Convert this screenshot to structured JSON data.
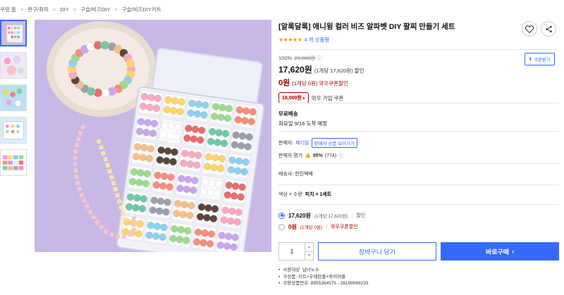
{
  "breadcrumb": [
    "쿠팡 홈",
    "완구/취미",
    "DIY",
    "구슬/비즈DIY",
    "구슬/비즈DIY키트"
  ],
  "product": {
    "title": "[알록달록] 애니윙 컬러 비즈 알파벳 DIY 팔찌 만들기 세트",
    "stars": "★★★★★",
    "review_count": "4 개 상품평"
  },
  "price": {
    "discount_rate": "100%",
    "original_price": "29,800원",
    "sale_price": "17,620원",
    "sale_unit": "(1개당 17,620원) 할인",
    "coupon_price": "0원",
    "coupon_unit": "(1개당 0원) 와우쿠폰할인",
    "coupon_button": "쿠폰받기",
    "wow_badge": "18,000원",
    "wow_text": "와우 가입 쿠폰"
  },
  "shipping": {
    "title": "무료배송",
    "date": "화요일 9/16 도착 예정"
  },
  "seller": {
    "label": "판매자:",
    "name": "페리알",
    "more_button": "판매자 상품 보러가기",
    "rating_label": "판매자 평가",
    "rating_value": "95%",
    "rating_count": "(774)"
  },
  "delivery_type": "배송사: 한진택배",
  "option_summary": {
    "prefix": "색상 × 수량: ",
    "value": "피치 × 1세트"
  },
  "options": [
    {
      "price": "17,620원",
      "sub": "(1개당 17,620원)",
      "tag": "할인",
      "selected": true
    },
    {
      "price": "0원",
      "sub": "(1개당 0원)",
      "tag": "와우쿠폰할인",
      "selected": false
    }
  ],
  "actions": {
    "quantity": "1",
    "cart_label": "장바구니 담기",
    "buy_label": "바로구매"
  },
  "details": [
    "사용대상: 남녀노소",
    "구성품: 키트+우레탄줄+와이어줄",
    "쿠팡상품번호: 8955364575 - 26199069233"
  ],
  "colors": {
    "accent": "#346aff",
    "coupon_red": "#ae0000",
    "star": "#ff9600",
    "image_bg": "#c7b8e6"
  },
  "icons": {
    "share": "share-icon",
    "wishlist": "heart-icon"
  }
}
